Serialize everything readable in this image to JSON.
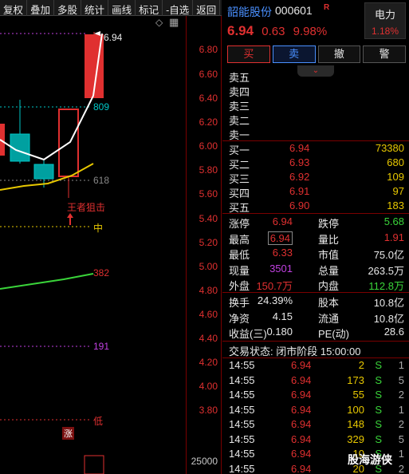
{
  "toolbar": [
    "复权",
    "叠加",
    "多股",
    "统计",
    "画线",
    "标记",
    "-自选",
    "返回"
  ],
  "chart": {
    "y_ticks": [
      "6.80",
      "6.60",
      "6.40",
      "6.20",
      "6.00",
      "5.80",
      "5.60",
      "5.40",
      "5.20",
      "5.00",
      "4.80",
      "4.60",
      "4.40",
      "4.20",
      "4.00",
      "3.80"
    ],
    "vol_tick": "25000",
    "high_label": "6.94",
    "line_labels": {
      "l809": "809",
      "l618": "618",
      "mid": "中",
      "l382": "382",
      "l191": "191",
      "low": "低"
    },
    "annotation": "王者狙击",
    "zhang_mark": "涨",
    "corner_icon": "◇",
    "grid_icon": "▦"
  },
  "header": {
    "stock_name": "韶能股份",
    "stock_code": "000601",
    "r_mark": "R",
    "price": "6.94",
    "change": "0.63",
    "change_pct": "9.98%",
    "sector_name": "电力",
    "sector_pct": "1.18%"
  },
  "buttons": {
    "buy": "买",
    "sell": "卖",
    "cancel": "撤",
    "alert": "警"
  },
  "collapse_icon": "⌄",
  "asks": [
    {
      "label": "卖五",
      "price": "",
      "vol": ""
    },
    {
      "label": "卖四",
      "price": "",
      "vol": ""
    },
    {
      "label": "卖三",
      "price": "",
      "vol": ""
    },
    {
      "label": "卖二",
      "price": "",
      "vol": ""
    },
    {
      "label": "卖一",
      "price": "",
      "vol": ""
    }
  ],
  "bids": [
    {
      "label": "买一",
      "price": "6.94",
      "vol": "73380"
    },
    {
      "label": "买二",
      "price": "6.93",
      "vol": "680"
    },
    {
      "label": "买三",
      "price": "6.92",
      "vol": "109"
    },
    {
      "label": "买四",
      "price": "6.91",
      "vol": "97"
    },
    {
      "label": "买五",
      "price": "6.90",
      "vol": "183"
    }
  ],
  "stats": {
    "limit_up_l": "涨停",
    "limit_up": "6.94",
    "limit_down_l": "跌停",
    "limit_down": "5.68",
    "high_l": "最高",
    "high": "6.94",
    "vol_ratio_l": "量比",
    "vol_ratio": "1.91",
    "low_l": "最低",
    "low": "6.33",
    "mktcap_l": "市值",
    "mktcap": "75.0亿",
    "cur_vol_l": "现量",
    "cur_vol": "3501",
    "total_vol_l": "总量",
    "total_vol": "263.5万",
    "outer_l": "外盘",
    "outer": "150.7万",
    "inner_l": "内盘",
    "inner": "112.8万",
    "turnover_l": "换手",
    "turnover": "24.39%",
    "share_l": "股本",
    "share": "10.8亿",
    "net_asset_l": "净资",
    "net_asset": "4.15",
    "float_l": "流通",
    "float": "10.8亿",
    "eps_l": "收益(三)",
    "eps": "0.180",
    "pe_l": "PE(动)",
    "pe": "28.6"
  },
  "status": "交易状态: 闭市阶段 15:00:00",
  "ticks": [
    {
      "time": "14:55",
      "price": "6.94",
      "vol": "2",
      "side": "S",
      "count": "1"
    },
    {
      "time": "14:55",
      "price": "6.94",
      "vol": "173",
      "side": "S",
      "count": "5"
    },
    {
      "time": "14:55",
      "price": "6.94",
      "vol": "55",
      "side": "S",
      "count": "2"
    },
    {
      "time": "14:55",
      "price": "6.94",
      "vol": "100",
      "side": "S",
      "count": "1"
    },
    {
      "time": "14:55",
      "price": "6.94",
      "vol": "148",
      "side": "S",
      "count": "2"
    },
    {
      "time": "14:55",
      "price": "6.94",
      "vol": "329",
      "side": "S",
      "count": "5"
    },
    {
      "time": "14:55",
      "price": "6.94",
      "vol": "10",
      "side": "S",
      "count": "1"
    },
    {
      "time": "14:55",
      "price": "6.94",
      "vol": "20",
      "side": "S",
      "count": "2"
    }
  ],
  "watermark": "股海游侠",
  "colors": {
    "up": "#e03030",
    "down": "#3ad43a",
    "cyan": "#00c8c8",
    "yellow": "#e8c800",
    "purple": "#c040e0",
    "blue": "#4a90ff"
  }
}
